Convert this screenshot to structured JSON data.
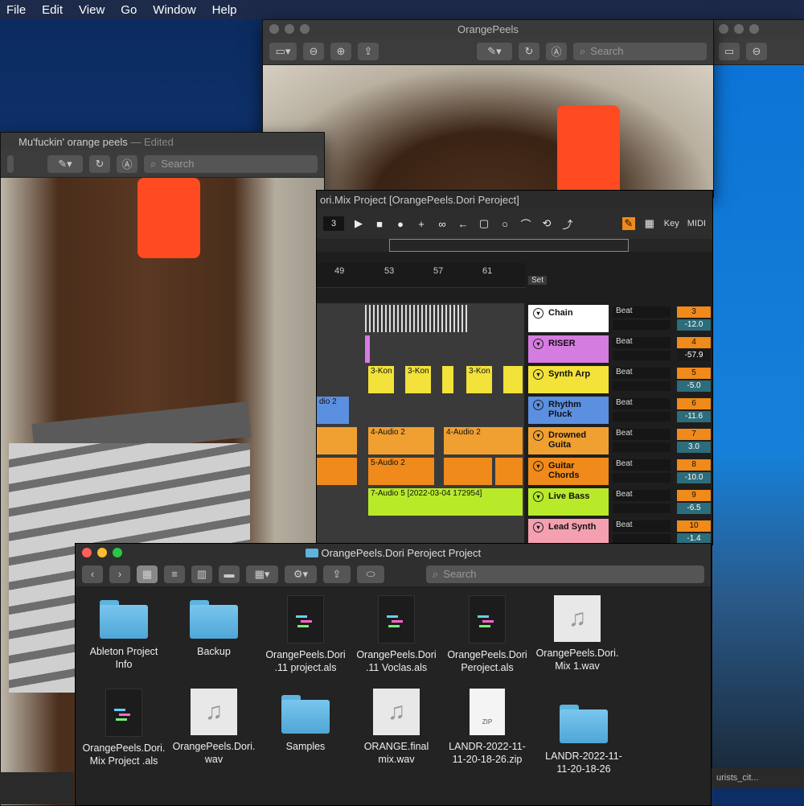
{
  "menubar": {
    "items": [
      "File",
      "Edit",
      "View",
      "Go",
      "Window",
      "Help"
    ]
  },
  "preview_back": {
    "title": "OrangePeels",
    "search_placeholder": "Search"
  },
  "preview_front": {
    "title": "Mu'fuckin' orange peels",
    "edited": "— Edited",
    "search_placeholder": "Search"
  },
  "ableton": {
    "title": "ori.Mix Project  [OrangePeels.Dori Peroject]",
    "bar_field": "3",
    "key_label": "Key",
    "midi_label": "MIDI",
    "set_label": "Set",
    "ruler": [
      "49",
      "53",
      "57",
      "61"
    ],
    "tracks": [
      {
        "name": "Chain",
        "color": "#ffffff",
        "mode": "Beat",
        "number": "3",
        "volume": "-12.0"
      },
      {
        "name": "RISER",
        "color": "#d57ce0",
        "mode": "Beat",
        "number": "4",
        "volume": "-57.9"
      },
      {
        "name": "Synth Arp",
        "color": "#f2e23a",
        "mode": "Beat",
        "number": "5",
        "volume": "-5.0"
      },
      {
        "name": "Rhythm Pluck",
        "color": "#5b8fe0",
        "mode": "Beat",
        "number": "6",
        "volume": "-11.6"
      },
      {
        "name": "Drowned Guita",
        "color": "#f0a030",
        "mode": "Beat",
        "number": "7",
        "volume": "3.0"
      },
      {
        "name": "Guitar Chords",
        "color": "#f08a1a",
        "mode": "Beat",
        "number": "8",
        "volume": "-10.0"
      },
      {
        "name": "Live Bass",
        "color": "#b8ea2a",
        "mode": "Beat",
        "number": "9",
        "volume": "-6.5"
      },
      {
        "name": "Lead Synth",
        "color": "#f4a0b0",
        "mode": "Beat",
        "number": "10",
        "volume": "-1.4"
      }
    ],
    "clip_labels": {
      "synth": "3-Kon",
      "rhythm": "dio 2",
      "drowned": "4-Audio 2",
      "guitar": "5-Audio 2",
      "bass": "7-Audio 5 [2022-03-04 172954]"
    }
  },
  "finder": {
    "title": "OrangePeels.Dori Peroject Project",
    "search_placeholder": "Search",
    "items": [
      {
        "line1": "Ableton Project",
        "line2": "Info",
        "kind": "folder"
      },
      {
        "line1": "Backup",
        "line2": "",
        "kind": "folder"
      },
      {
        "line1": "OrangePeels.Dori",
        "line2": ".11 project.als",
        "kind": "als"
      },
      {
        "line1": "OrangePeels.Dori",
        "line2": ".11 Voclas.als",
        "kind": "als"
      },
      {
        "line1": "OrangePeels.Dori",
        "line2": "Peroject.als",
        "kind": "als"
      },
      {
        "line1": "OrangePeels.Dori.",
        "line2": "Mix 1.wav",
        "kind": "wav"
      },
      {
        "line1": "OrangePeels.Dori.",
        "line2": "Mix Project .als",
        "kind": "als"
      },
      {
        "line1": "OrangePeels.Dori.",
        "line2": "wav",
        "kind": "wav"
      },
      {
        "line1": "Samples",
        "line2": "",
        "kind": "folder"
      },
      {
        "line1": "ORANGE.final",
        "line2": "mix.wav",
        "kind": "wav"
      },
      {
        "line1": "LANDR-2022-11-",
        "line2": "11-20-18-26.zip",
        "kind": "zip"
      },
      {
        "line1": "LANDR-2022-11-",
        "line2": "11-20-18-26",
        "kind": "folder"
      }
    ],
    "zip_label": "ZIP"
  },
  "right_window": {
    "caption": "urists_cit..."
  },
  "colors": {
    "close": "#ff5f57",
    "minimize": "#febc2e",
    "zoom": "#28c840",
    "accent": "#f08a1a"
  }
}
